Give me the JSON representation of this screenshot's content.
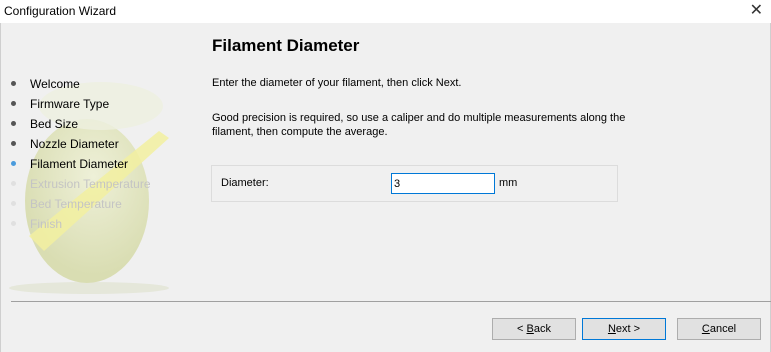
{
  "window": {
    "title": "Configuration Wizard",
    "close_glyph": "✕"
  },
  "steps": [
    {
      "label": "Welcome",
      "state": "done"
    },
    {
      "label": "Firmware Type",
      "state": "done"
    },
    {
      "label": "Bed Size",
      "state": "done"
    },
    {
      "label": "Nozzle Diameter",
      "state": "done"
    },
    {
      "label": "Filament Diameter",
      "state": "current"
    },
    {
      "label": "Extrusion Temperature",
      "state": "todo"
    },
    {
      "label": "Bed Temperature",
      "state": "todo"
    },
    {
      "label": "Finish",
      "state": "todo"
    }
  ],
  "page": {
    "heading": "Filament Diameter",
    "instruction": "Enter the diameter of your filament, then click Next.",
    "note": "Good precision is required, so use a caliper and do multiple measurements along the filament, then compute the average."
  },
  "diameter_field": {
    "label": "Diameter:",
    "value": "3",
    "unit": "mm"
  },
  "buttons": {
    "back": {
      "mnemonic": "B",
      "before": "< ",
      "after": "ack"
    },
    "next": {
      "mnemonic": "N",
      "before": "",
      "after": "ext >"
    },
    "cancel": {
      "mnemonic": "C",
      "before": "",
      "after": "ancel"
    }
  },
  "colors": {
    "current_step_dot": "#4a9bdc",
    "focus_border": "#0078d7",
    "disabled_text": "#c4c4c4"
  }
}
